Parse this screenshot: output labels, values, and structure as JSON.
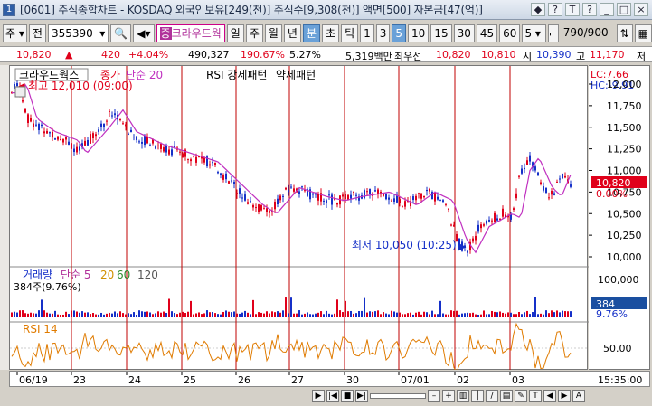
{
  "window": {
    "number": "1",
    "title": "[0601] 주식종합차트 - KOSDAQ 외국인보유[249(천)] 주식수[9,308(천)] 액면[500] 자본금[47(억)]",
    "controls": [
      "◆",
      "?",
      "T",
      "?",
      "_",
      "□",
      "×"
    ]
  },
  "toolbar": {
    "market": "주",
    "market_alt": "전",
    "code": "355390",
    "crowd_prefix": "증",
    "crowd_name": "크라우드웍",
    "periods": [
      "일",
      "주",
      "월",
      "년",
      "분",
      "초",
      "틱"
    ],
    "selected_period": "분",
    "intervals": [
      "1",
      "3",
      "5",
      "10",
      "15",
      "30",
      "45",
      "60"
    ],
    "selected_interval": "5",
    "count": "5",
    "range": "790/900"
  },
  "price_row": {
    "price": "10,820",
    "change": "420",
    "change_pct": "+4.04%",
    "volume": "490,327",
    "vol_ratio": "190.67%",
    "turnover": "5.27%",
    "amount": "5,319백만",
    "best_bid_label": "최우선",
    "ask": "10,820",
    "bid": "10,810",
    "open_label": "시",
    "open": "10,390",
    "high_label": "고",
    "high": "11,170",
    "low_label": "저"
  },
  "legend": {
    "name": "크라우드웍스",
    "price_series": "종가",
    "ma": "단순 20",
    "rsi_pattern": "RSI 강세패턴",
    "weak_pattern": "약세패턴"
  },
  "annotations": {
    "high": "최고 12,010 (09:00)",
    "low": "최저 10,050 (10:25)",
    "lc": "LC:7.66",
    "hc": "HC:-9.91"
  },
  "price_axis": {
    "ticks": [
      "12,000",
      "11,750",
      "11,500",
      "11,250",
      "11,000",
      "10,750",
      "10,500",
      "10,250",
      "10,000"
    ],
    "current_price": "10,820",
    "current_pct": "0.00%"
  },
  "volume_panel": {
    "label": "거래량",
    "ma_label": "단순 5",
    "ma_periods": [
      "20",
      "60",
      "120"
    ],
    "shares": "384주(9.76%)",
    "axis_tick": "100,000",
    "current": "384",
    "current_pct": "9.76%"
  },
  "rsi_panel": {
    "label": "RSI 14",
    "axis_tick": "50.00"
  },
  "dates": [
    "06/19",
    "23",
    "24",
    "25",
    "26",
    "27",
    "30",
    "07/01",
    "02",
    "03"
  ],
  "time_label": "15:35:00",
  "colors": {
    "up": "#e0001a",
    "down": "#1530c8",
    "ma": "#c030c0",
    "rsi": "#e07b00",
    "session_line": "#c00000",
    "current_badge": "#e0001a",
    "volume_badge": "#1a4fa0"
  }
}
